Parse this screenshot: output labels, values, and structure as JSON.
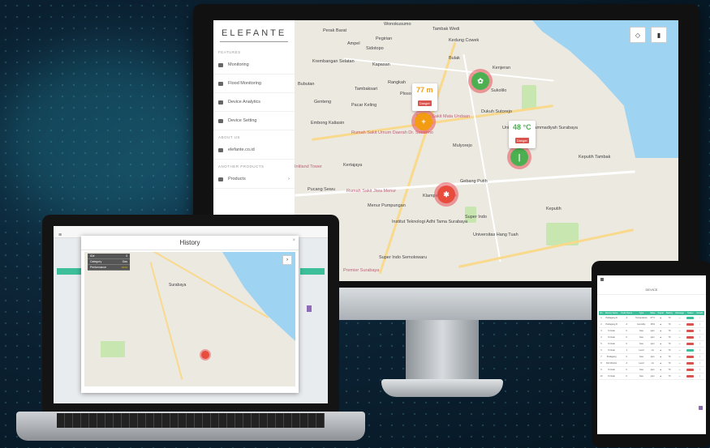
{
  "sidebar": {
    "logo": "ELEFANTE",
    "sections": [
      "FEATURES",
      "ABOUT US",
      "ANOTHER PRODUCTS"
    ],
    "items": [
      {
        "label": "Monitoring",
        "icon": "monitor-icon"
      },
      {
        "label": "Flood Monitoring",
        "icon": "flood-icon"
      },
      {
        "label": "Device Analytics",
        "icon": "analytics-icon"
      },
      {
        "label": "Device Setting",
        "icon": "settings-icon"
      },
      {
        "label": "elefante.co.id",
        "icon": "web-icon"
      },
      {
        "label": "Products",
        "icon": "products-icon"
      }
    ]
  },
  "map": {
    "labels": [
      "Perak Barat",
      "Wonokusumo",
      "Tambak Wedi",
      "Kedung Cowek",
      "Ampel",
      "Pegirian",
      "Sidotopo",
      "Bulak",
      "Krembangan Selatan",
      "Kapasan",
      "Kenjeran",
      "Tambaksari",
      "Rangkah",
      "Bubutan",
      "Genteng",
      "Pacar Keling",
      "Ploso",
      "Sukolilo",
      "Embong Kaliasin",
      "Dukuh Sutorejo",
      "Mulyorejo",
      "Kertajaya",
      "Gebang Putih",
      "Keputih Tambak",
      "Pucang Sewu",
      "Menur Pumpungan",
      "Klampis Ngasem",
      "Keputih",
      "Universitas Muhammadiyah Surabaya",
      "Institut Teknologi Adhi Tama Surabaya",
      "Super Indo",
      "Universitas Hang Tuah",
      "Super Indo Semolowaru",
      "Surabaya"
    ],
    "red_labels": [
      "Rumah Sakit Umum Daerah Dr. Soetomo",
      "Rumah Sakit Jiwa Menur",
      "Rumah Sakit Mata Undaan",
      "Premier Surabaya",
      "Intiland Tower"
    ],
    "popups": [
      {
        "value": "77 m",
        "badge": "Danger"
      },
      {
        "value": "48 °C",
        "badge": "Danger"
      }
    ]
  },
  "history": {
    "title": "History",
    "info_rows": [
      {
        "k": "ID#",
        "v": "3"
      },
      {
        "k": "Category",
        "v": "Gas"
      },
      {
        "k": "Performance",
        "v": "••••••"
      }
    ],
    "city_label": "Surabaya"
  },
  "tablet": {
    "title": "DEVICE",
    "headers": [
      "No",
      "Device Name",
      "Node Name",
      "Type",
      "Value",
      "Signal",
      "Battery",
      "Message",
      "Status",
      "Details"
    ],
    "rows": [
      [
        "1",
        "Pedagang D",
        "A",
        "Temperature",
        "37°C",
        "▲",
        "70",
        "—",
        "OK",
        "i"
      ],
      [
        "2",
        "Pedagang D",
        "A",
        "Humidity",
        "30%",
        "▲",
        "70",
        "—",
        "Danger",
        "i"
      ],
      [
        "3",
        "D-Gate",
        "C",
        "Gas",
        "ppm",
        "▲",
        "70",
        "—",
        "Danger",
        "i"
      ],
      [
        "4",
        "D-Gate",
        "C",
        "Gas",
        "ppm",
        "▲",
        "70",
        "—",
        "Danger",
        "i"
      ],
      [
        "5",
        "D-Gate",
        "C",
        "Gas",
        "ppm",
        "▲",
        "70",
        "—",
        "Danger",
        "i"
      ],
      [
        "6",
        "D-Gate",
        "1",
        "Level",
        "cm",
        "▲",
        "70",
        "—",
        "OK",
        "i"
      ],
      [
        "7",
        "Pedagang",
        "C",
        "Gas",
        "ppm",
        "▲",
        "70",
        "—",
        "Danger",
        "i"
      ],
      [
        "8",
        "Dsl Monitor",
        "A",
        "Level",
        "cm",
        "▲",
        "70",
        "—",
        "Danger",
        "i"
      ],
      [
        "9",
        "D-Gate",
        "C",
        "Gas",
        "ppm",
        "▲",
        "70",
        "—",
        "Danger",
        "i"
      ],
      [
        "10",
        "D-Gate",
        "C",
        "Gas",
        "ppm",
        "▲",
        "70",
        "—",
        "Danger",
        "i"
      ]
    ]
  },
  "colors": {
    "danger": "#d9534f",
    "ok": "#3cbf9a",
    "accent": "#3cbf9a"
  }
}
